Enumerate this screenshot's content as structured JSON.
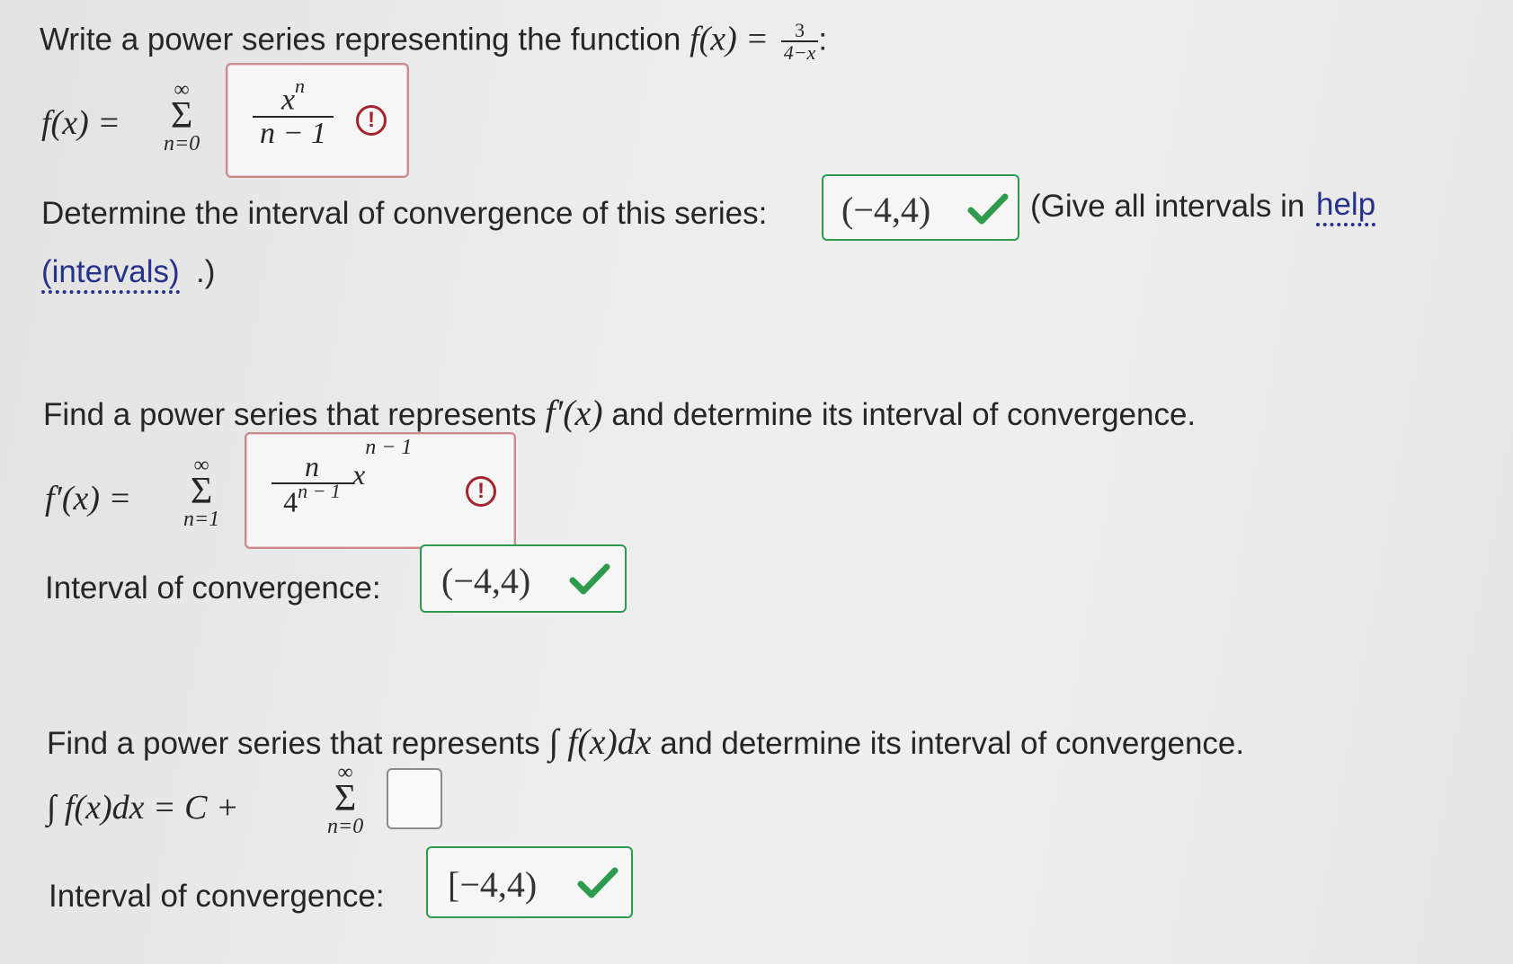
{
  "q1": {
    "prompt": "Write a power series representing the function",
    "fx": "f(x) =",
    "fn_num": "3",
    "fn_den": "4−x",
    "colon": ":",
    "lhs": "f(x) =",
    "sum_upper": "∞",
    "sum_sigma": "Σ",
    "sum_lower": "n=0",
    "answer_num": "x",
    "answer_num_exp": "n",
    "answer_den": "n − 1",
    "status": "incorrect",
    "status_icon": "warning-circle-icon"
  },
  "q2": {
    "prompt": "Determine the interval of convergence of this series:",
    "answer": "(−4,4)",
    "status": "correct",
    "status_icon": "checkmark-icon",
    "hint_prefix": "(Give all intervals in",
    "hint_link1": "help",
    "hint_link2": "(intervals)",
    "hint_suffix": ".)"
  },
  "q3": {
    "prompt_a": "Find a power series that represents",
    "prompt_math": "f′(x)",
    "prompt_b": "and determine its interval of convergence.",
    "lhs": "f′(x) =",
    "sum_upper": "∞",
    "sum_sigma": "Σ",
    "sum_lower": "n=1",
    "answer_num": "n",
    "answer_den_base": "4",
    "answer_den_exp": "n − 1",
    "answer_x": "x",
    "answer_x_exp": "n − 1",
    "status": "incorrect",
    "status_icon": "warning-circle-icon",
    "interval_label": "Interval of convergence:",
    "interval_answer": "(−4,4)",
    "interval_status": "correct"
  },
  "q4": {
    "prompt_a": "Find a power series that represents",
    "prompt_math": "∫ f(x)dx",
    "prompt_b": "and determine its interval of convergence.",
    "lhs": "∫ f(x)dx = C +",
    "sum_upper": "∞",
    "sum_sigma": "Σ",
    "sum_lower": "n=0",
    "answer": "",
    "interval_label": "Interval of convergence:",
    "interval_answer": "[−4,4)",
    "interval_status": "correct"
  },
  "colors": {
    "correct": "#2e9a4c",
    "incorrect": "#a4242e",
    "link": "#26318a",
    "text": "#262626"
  }
}
